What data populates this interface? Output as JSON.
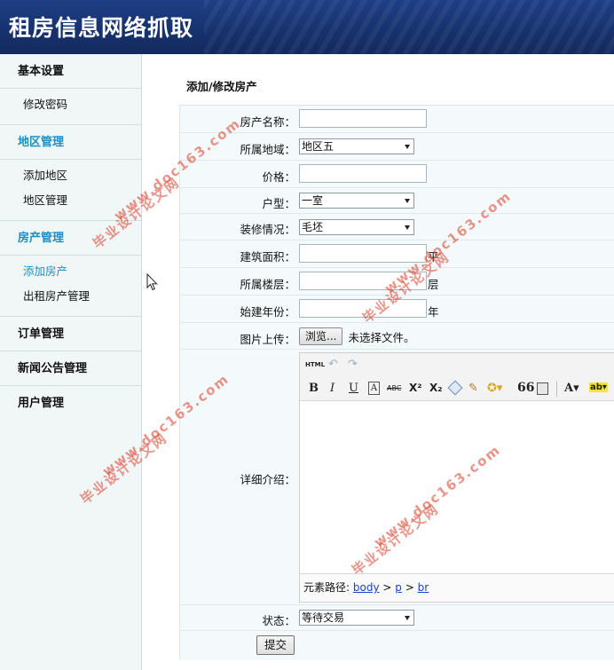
{
  "header": {
    "title": "租房信息网络抓取"
  },
  "sidebar": {
    "groups": [
      {
        "title": "基本设置",
        "items": [
          "修改密码"
        ]
      },
      {
        "title": "地区管理",
        "items": [
          "添加地区",
          "地区管理"
        ]
      },
      {
        "title": "房产管理",
        "items": [
          "添加房产",
          "出租房产管理"
        ]
      },
      {
        "title": "订单管理"
      },
      {
        "title": "新闻公告管理"
      },
      {
        "title": "用户管理"
      }
    ]
  },
  "main": {
    "page_title": "添加/修改房产",
    "form": {
      "name_label": "房产名称：",
      "name_value": "",
      "region_label": "所属地域：",
      "region_value": "地区五",
      "price_label": "价格：",
      "price_value": "",
      "layout_label": "户型：",
      "layout_value": "一室",
      "decoration_label": "装修情况：",
      "decoration_value": "毛坯",
      "area_label": "建筑面积：",
      "area_value": "",
      "area_unit": "平",
      "floor_label": "所属楼层：",
      "floor_value": "",
      "floor_unit": "层",
      "year_label": "始建年份：",
      "year_value": "",
      "year_unit": "年",
      "upload_label": "图片上传：",
      "browse_label": "浏览...",
      "no_file_text": "未选择文件。",
      "detail_label": "详细介绍：",
      "status_label": "状态：",
      "status_value": "等待交易",
      "submit_label": "提交"
    },
    "editor": {
      "html_label": "HTML",
      "path_label": "元素路径:",
      "path_items": [
        "body",
        "p",
        "br"
      ],
      "path_sep": ">",
      "bold_icon": "B",
      "italic_icon": "I",
      "underline_icon": "U",
      "sup_icon": "X²",
      "sub_icon": "X₂",
      "font_color_icon": "A",
      "quote_icon": "66"
    }
  },
  "watermark": {
    "text1": "毕业设计论文网",
    "text2": "www.doc163.com"
  }
}
